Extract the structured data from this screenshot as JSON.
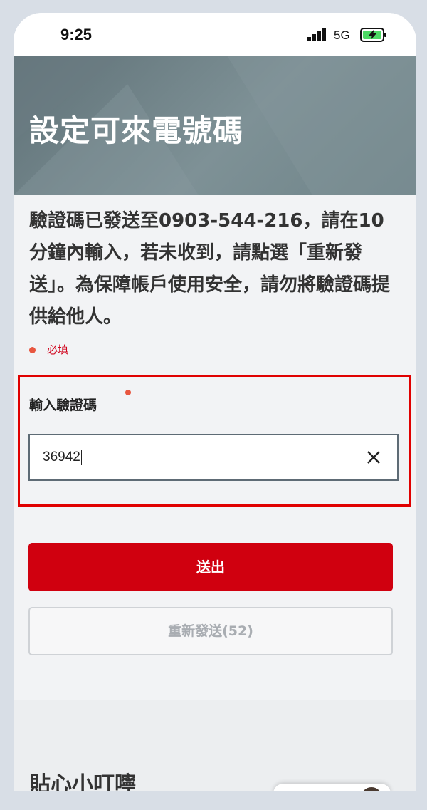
{
  "status_bar": {
    "time": "9:25",
    "network": "5G"
  },
  "hero": {
    "title": "設定可來電號碼"
  },
  "instructions": "驗證碼已發送至0903-544-216，請在10分鐘內輸入，若未收到，請點選「重新發送」。為保障帳戶使用安全，請勿將驗證碼提供給他人。",
  "required_note": "必填",
  "form": {
    "label": "輸入驗證碼",
    "value": "36942"
  },
  "buttons": {
    "submit": "送出",
    "resend": "重新發送(52)"
  },
  "tips": {
    "title": "貼心小叮嚀"
  },
  "colors": {
    "accent_red": "#d0000f",
    "required_dot": "#e8563f",
    "highlight_border": "#e00000",
    "hero_bg": "#7e9196"
  }
}
